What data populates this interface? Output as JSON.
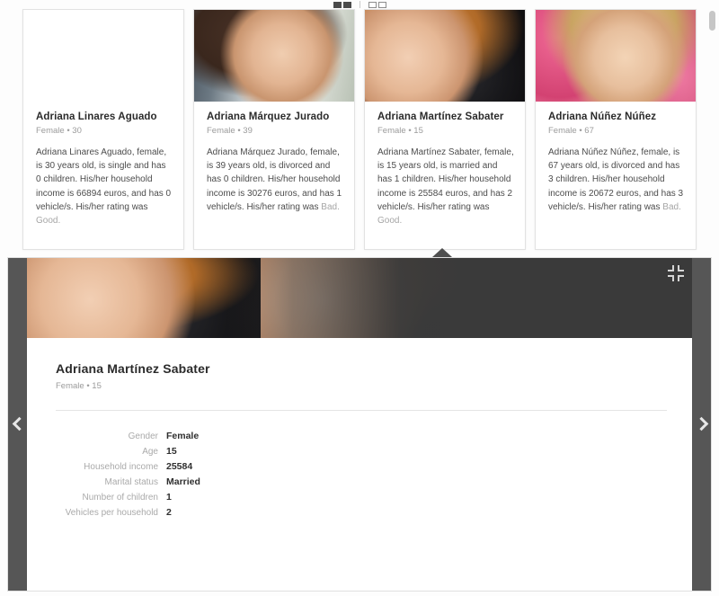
{
  "toolbar": {
    "view_grid_label": "grid-view",
    "view_list_label": "list-view"
  },
  "cards": [
    {
      "name": "Adriana Linares Aguado",
      "subtitle": "Female • 30",
      "description": "Adriana Linares Aguado, female, is 30 years old, is single and has 0 children. His/her household income is 66894 euros, and has 0 vehicle/s. His/her rating was ",
      "rating": "Good.",
      "photo": "portrait-blonde-closeup"
    },
    {
      "name": "Adriana Márquez Jurado",
      "subtitle": "Female • 39",
      "description": "Adriana Márquez Jurado, female, is 39 years old, is divorced and has 0 children. His/her household income is 30276 euros, and has 1 vehicle/s. His/her rating was ",
      "rating": "Bad.",
      "photo": "portrait-brunette-smiling"
    },
    {
      "name": "Adriana Martínez Sabater",
      "subtitle": "Female • 15",
      "description": "Adriana Martínez Sabater, female, is 15 years old, is married and has 1 children. His/her household income is 25584 euros, and has 2 vehicle/s. His/her rating was ",
      "rating": "Good.",
      "photo": "portrait-older-redhead"
    },
    {
      "name": "Adriana Núñez Núñez",
      "subtitle": "Female • 67",
      "description": "Adriana Núñez Núñez, female, is 67 years old, is divorced and has 3 children. His/her household income is 20672 euros, and has 3 vehicle/s. His/her rating was ",
      "rating": "Bad.",
      "photo": "portrait-blonde-pink-roses"
    }
  ],
  "detail": {
    "name": "Adriana Martínez Sabater",
    "subtitle": "Female • 15",
    "photo": "portrait-older-redhead",
    "collapse_label": "collapse",
    "prev_label": "previous",
    "next_label": "next",
    "fields": [
      {
        "label": "Gender",
        "value": "Female"
      },
      {
        "label": "Age",
        "value": "15"
      },
      {
        "label": "Household income",
        "value": "25584"
      },
      {
        "label": "Marital status",
        "value": "Married"
      },
      {
        "label": "Number of children",
        "value": "1"
      },
      {
        "label": "Vehicles per household",
        "value": "2"
      }
    ]
  },
  "colors": {
    "panel_dark": "#3a3a3a",
    "nav_strip": "#565656",
    "muted_text": "#9b9b9b",
    "body_text": "#4c4c4c"
  }
}
